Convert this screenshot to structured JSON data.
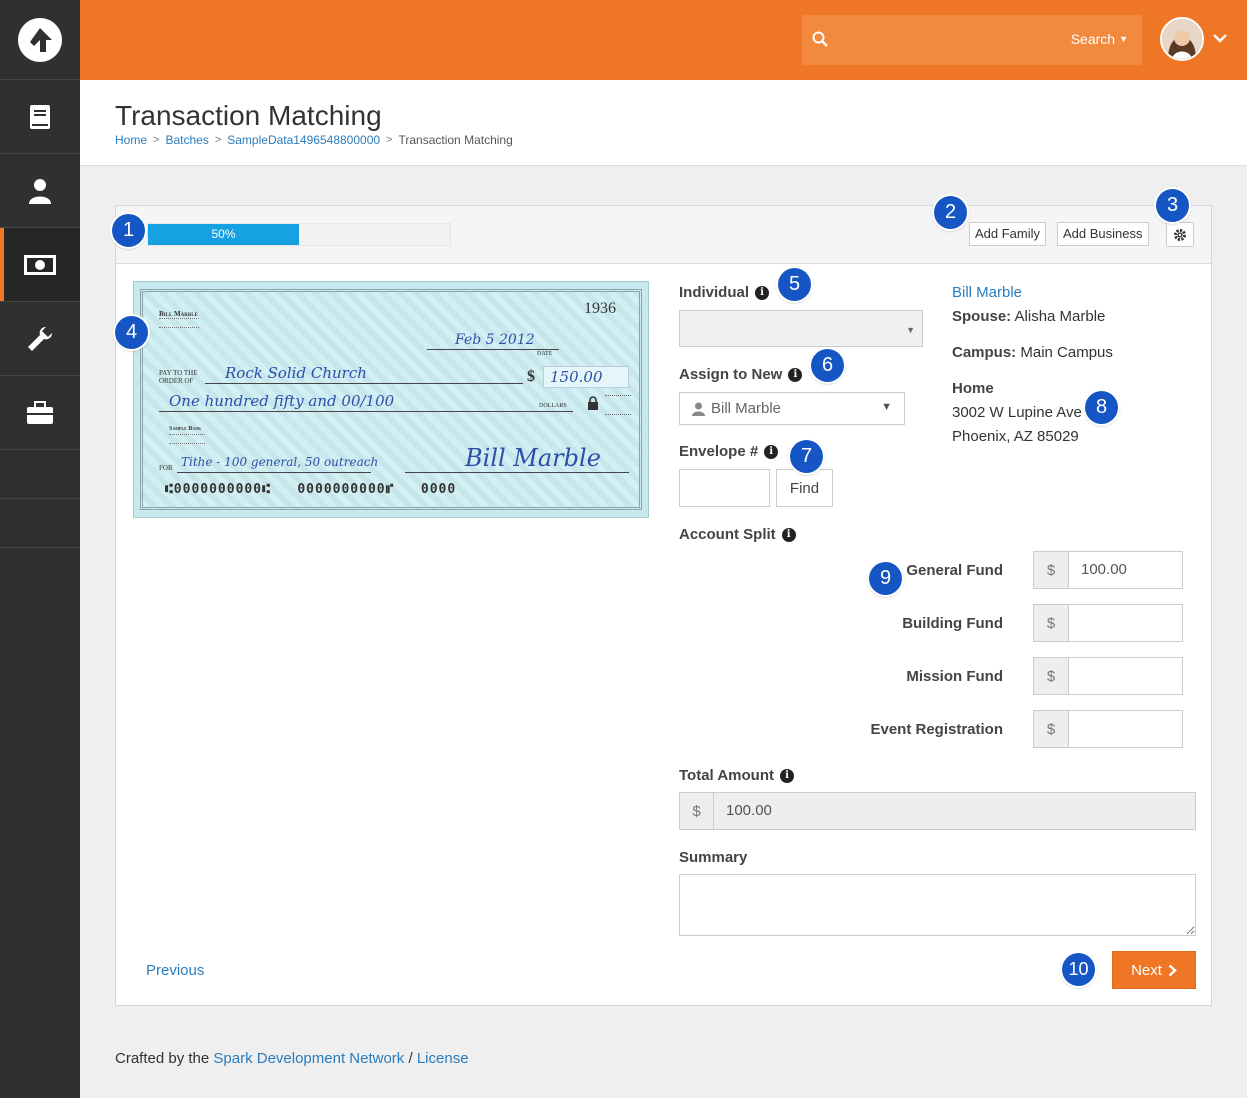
{
  "header": {
    "search_button": "Search",
    "search_placeholder": ""
  },
  "page": {
    "title": "Transaction Matching",
    "breadcrumb": [
      "Home",
      "Batches",
      "SampleData1496548800000",
      "Transaction Matching"
    ]
  },
  "toolbar": {
    "progress_label": "50%",
    "progress_value": 0.5,
    "add_family": "Add Family",
    "add_business": "Add Business"
  },
  "check": {
    "check_number": "1936",
    "owner_name": "Bill Marble",
    "date": "Feb 5 2012",
    "date_label": "DATE",
    "pay_to_label_1": "PAY TO THE",
    "pay_to_label_2": "ORDER OF",
    "payee": "Rock Solid Church",
    "amount": "150.00",
    "amount_words": "One hundred fifty and 00/100",
    "dollars_label": "DOLLARS",
    "bank_name": "Sample Bank",
    "for_label": "FOR",
    "memo": "Tithe - 100 general, 50 outreach",
    "signature": "Bill Marble",
    "micr": "⑆0000000000⑆   0000000000⑈   0000"
  },
  "form": {
    "individual_label": "Individual",
    "assign_label": "Assign to New",
    "assign_value": "Bill Marble",
    "envelope_label": "Envelope #",
    "find_button": "Find",
    "account_split_label": "Account Split",
    "funds": [
      {
        "name": "General Fund",
        "value": "100.00"
      },
      {
        "name": "Building Fund",
        "value": ""
      },
      {
        "name": "Mission Fund",
        "value": ""
      },
      {
        "name": "Event Registration",
        "value": ""
      }
    ],
    "currency_symbol": "$",
    "total_label": "Total Amount",
    "total_value": "100.00",
    "summary_label": "Summary",
    "summary_value": ""
  },
  "person": {
    "name": "Bill Marble",
    "spouse_label": "Spouse:",
    "spouse": "Alisha Marble",
    "campus_label": "Campus:",
    "campus": "Main Campus",
    "home_label": "Home",
    "address_1": "3002 W Lupine Ave",
    "address_2": "Phoenix, AZ 85029"
  },
  "nav": {
    "previous": "Previous",
    "next": "Next"
  },
  "badges": [
    "1",
    "2",
    "3",
    "4",
    "5",
    "6",
    "7",
    "8",
    "9",
    "10"
  ],
  "footer": {
    "prefix": "Crafted by the",
    "link": "Spark Development Network",
    "separator": "/",
    "license": "License"
  },
  "colors": {
    "accent": "#ee7624",
    "progress": "#16a1e3",
    "link": "#2a7dbf",
    "badge": "#1656c4",
    "sidebar": "#303030"
  }
}
